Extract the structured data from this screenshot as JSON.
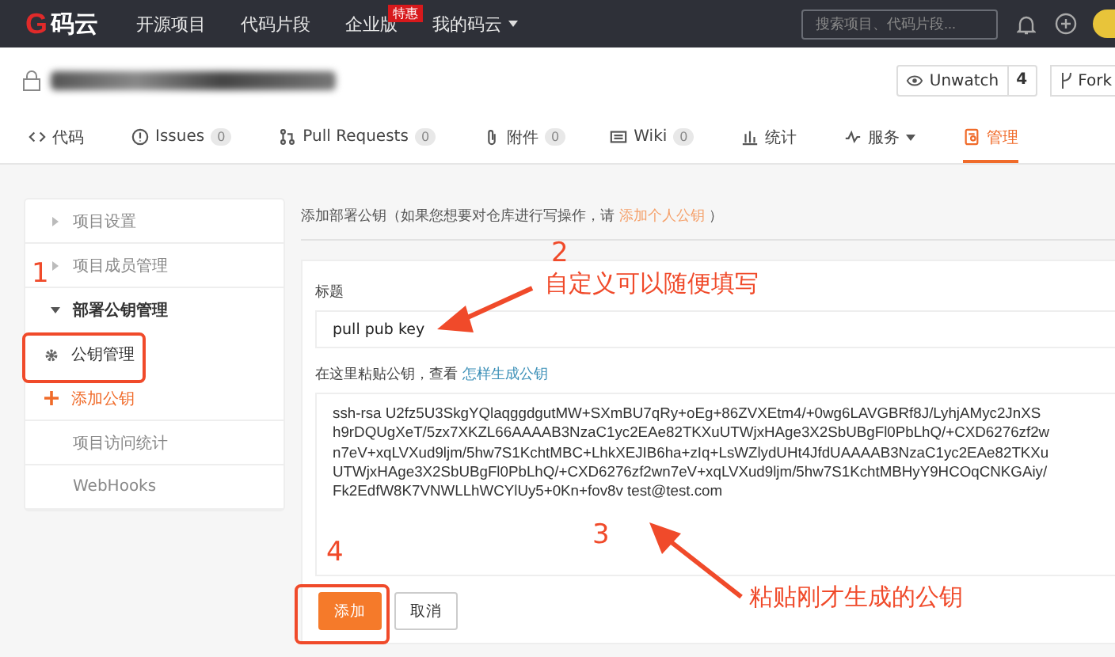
{
  "topbar": {
    "logo_mark": "G",
    "logo": "码云",
    "nav": [
      {
        "label": "开源项目"
      },
      {
        "label": "代码片段"
      },
      {
        "label": "企业版",
        "badge": "特惠"
      },
      {
        "label": "我的码云",
        "dropdown": true
      }
    ],
    "search": {
      "placeholder": "搜索项目、代码片段..."
    }
  },
  "repo": {
    "watch": {
      "label": "Unwatch",
      "count": "4"
    },
    "fork": {
      "label": "Fork"
    }
  },
  "tabs": [
    {
      "label": "代码",
      "selected": false
    },
    {
      "label": "Issues",
      "count": "0",
      "selected": false
    },
    {
      "label": "Pull Requests",
      "count": "0",
      "selected": false
    },
    {
      "label": "附件",
      "count": "0",
      "selected": false
    },
    {
      "label": "Wiki",
      "count": "0",
      "selected": false
    },
    {
      "label": "统计",
      "selected": false
    },
    {
      "label": "服务",
      "dropdown": true,
      "selected": false
    },
    {
      "label": "管理",
      "selected": true
    }
  ],
  "sidebar": {
    "items": [
      {
        "label": "项目设置",
        "kind": "group",
        "expanded": false
      },
      {
        "label": "项目成员管理",
        "kind": "group",
        "expanded": false
      },
      {
        "label": "部署公钥管理",
        "kind": "group",
        "expanded": true,
        "children": [
          {
            "label": "公钥管理",
            "kind": "gear"
          },
          {
            "label": "添加公钥",
            "kind": "add"
          }
        ]
      },
      {
        "label": "项目访问统计",
        "kind": "link"
      },
      {
        "label": "WebHooks",
        "kind": "link"
      }
    ]
  },
  "form": {
    "intro": {
      "before": "添加部署公钥（如果您想要对仓库进行写操作，请 ",
      "link": "添加个人公钥",
      "after": " ）"
    },
    "title_label": "标题",
    "title_value": "pull pub key",
    "key_label": {
      "before": "在这里粘贴公钥，查看 ",
      "link": "怎样生成公钥"
    },
    "key_lines": [
      "ssh-rsa U2fz5U3SkgYQlaqggdgutMW+SXmBU7qRy+oEg+86ZVXEtm4/+0wg6LAVGBRf8J/LyhjAMyc2JnXS",
      "h9rDQUgXeT/5zx7XKZL66AAAAB3NzaC1yc2EAe82TKXuUTWjxHAge3X2SbUBgFl0PbLhQ/+CXD6276zf2w",
      "n7eV+xqLVXud9ljm/5hw7S1KchtMBC+LhkXEJIB6ha+zIq+LsWZlydUHt4JfdUAAAAB3NzaC1yc2EAe82TKXu",
      "UTWjxHAge3X2SbUBgFl0PbLhQ/+CXD6276zf2wn7eV+xqLVXud9ljm/5hw7S1KchtMBHyY9HCOqCNKGAiy/",
      "Fk2EdfW8K7VNWLLhWCYlUy5+0Kn+fov8v test@test.com"
    ],
    "buttons": [
      {
        "label": "添加",
        "kind": "primary"
      },
      {
        "label": "取消",
        "kind": "default"
      }
    ]
  },
  "annotations": {
    "markers": [
      "1",
      "2",
      "3",
      "4"
    ],
    "notes": [
      "自定义可以随便填写",
      "粘贴刚才生成的公钥"
    ]
  }
}
